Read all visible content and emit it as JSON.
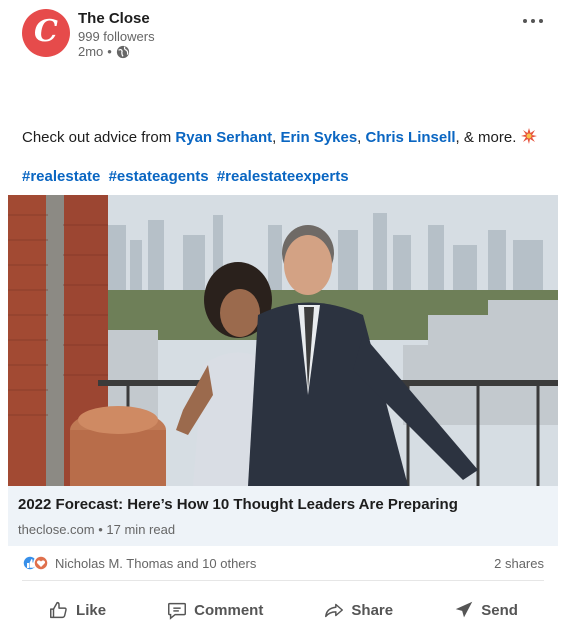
{
  "post": {
    "company_name": "The Close",
    "avatar_letter": "C",
    "followers": "999 followers",
    "time": "2mo",
    "time_separator": "•",
    "more_icon": "more-dots-icon",
    "text_prefix": "Check out advice from ",
    "mentions": [
      "Ryan Serhant",
      "Erin Sykes",
      "Chris Linsell"
    ],
    "text_sep1": ", ",
    "text_sep2": ", ",
    "text_suffix": ", & more. ",
    "hashtags": [
      "#realestate",
      "#estateagents",
      "#realestateexperts"
    ]
  },
  "link_card": {
    "title": "2022 Forecast: Here’s How 10 Thought Leaders Are Preparing",
    "source": "theclose.com",
    "sep": "•",
    "read_time": "17 min read"
  },
  "social": {
    "reactors": "Nicholas M. Thomas and 10 others",
    "shares": "2 shares"
  },
  "actions": {
    "like": "Like",
    "comment": "Comment",
    "share": "Share",
    "send": "Send"
  },
  "colors": {
    "brand_red": "#e64b4b",
    "link_blue": "#0a66c2",
    "card_bg": "#eef3f8"
  }
}
